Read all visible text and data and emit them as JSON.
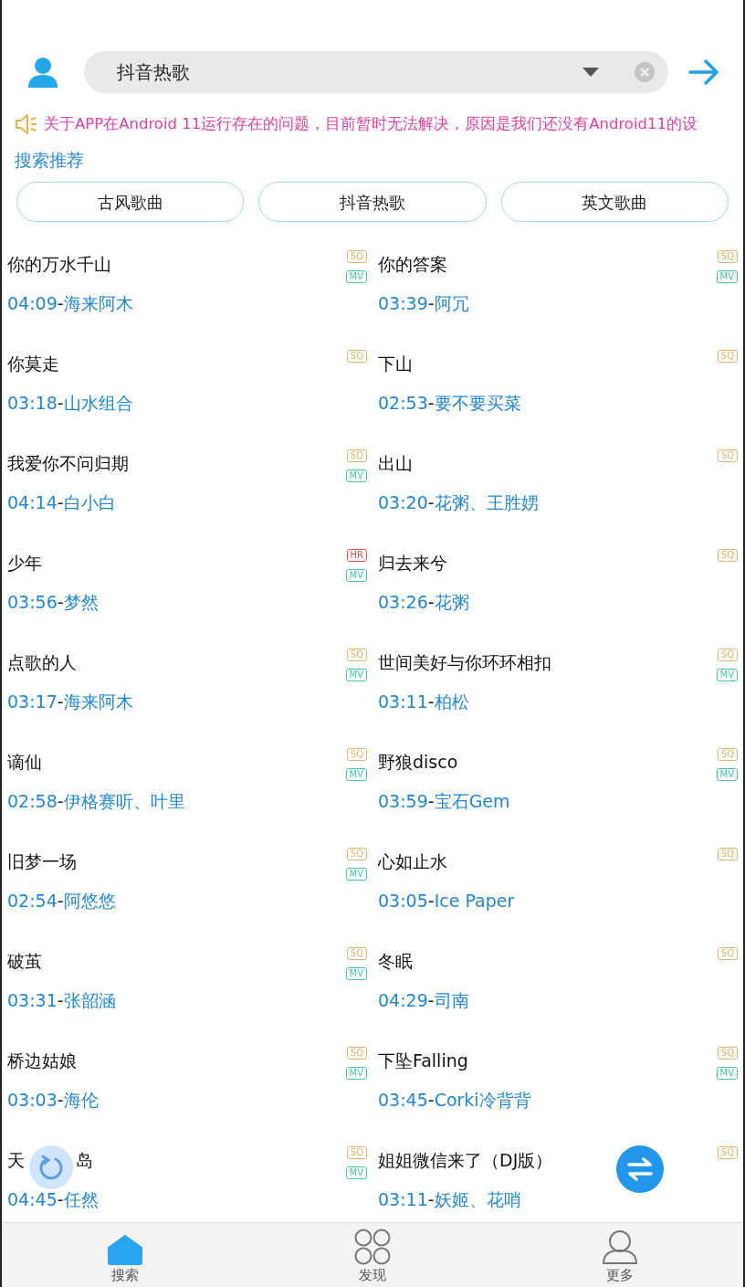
{
  "search": {
    "value": "抖音热歌"
  },
  "notice": "关于APP在Android 11运行存在的问题，目前暂时无法解决，原因是我们还没有Android11的设",
  "recommend": {
    "heading": "搜索推荐",
    "chips": [
      "古风歌曲",
      "抖音热歌",
      "英文歌曲"
    ]
  },
  "songs": [
    {
      "title": "你的万水千山",
      "duration": "04:09",
      "separator": "-",
      "artist": "海来阿木",
      "badges": [
        {
          "kind": "sq",
          "label": "SQ"
        },
        {
          "kind": "mv",
          "label": "MV"
        }
      ]
    },
    {
      "title": "你的答案",
      "duration": "03:39",
      "separator": "-",
      "artist": "阿冗",
      "badges": [
        {
          "kind": "sq",
          "label": "SQ"
        },
        {
          "kind": "mv",
          "label": "MV"
        }
      ]
    },
    {
      "title": "你莫走",
      "duration": "03:18",
      "separator": "-",
      "artist": "山水组合",
      "badges": [
        {
          "kind": "sq",
          "label": "SQ"
        }
      ]
    },
    {
      "title": "下山",
      "duration": "02:53",
      "separator": "-",
      "artist": "要不要买菜",
      "badges": [
        {
          "kind": "sq",
          "label": "SQ"
        }
      ]
    },
    {
      "title": "我爱你不问归期",
      "duration": "04:14",
      "separator": "-",
      "artist": "白小白",
      "badges": [
        {
          "kind": "sq",
          "label": "SQ"
        },
        {
          "kind": "mv",
          "label": "MV"
        }
      ]
    },
    {
      "title": "出山",
      "duration": "03:20",
      "separator": "-",
      "artist": "花粥、王胜娚",
      "badges": [
        {
          "kind": "sq",
          "label": "SQ"
        }
      ]
    },
    {
      "title": "少年",
      "duration": "03:56",
      "separator": "-",
      "artist": "梦然",
      "badges": [
        {
          "kind": "hr",
          "label": "HR"
        },
        {
          "kind": "mv",
          "label": "MV"
        }
      ]
    },
    {
      "title": "归去来兮",
      "duration": "03:26",
      "separator": "-",
      "artist": "花粥",
      "badges": [
        {
          "kind": "sq",
          "label": "SQ"
        }
      ]
    },
    {
      "title": "点歌的人",
      "duration": "03:17",
      "separator": "-",
      "artist": "海来阿木",
      "badges": [
        {
          "kind": "sq",
          "label": "SQ"
        },
        {
          "kind": "mv",
          "label": "MV"
        }
      ]
    },
    {
      "title": "世间美好与你环环相扣",
      "duration": "03:11",
      "separator": "-",
      "artist": "柏松",
      "badges": [
        {
          "kind": "sq",
          "label": "SQ"
        },
        {
          "kind": "mv",
          "label": "MV"
        }
      ]
    },
    {
      "title": "谪仙",
      "duration": "02:58",
      "separator": "-",
      "artist": "伊格赛听、叶里",
      "badges": [
        {
          "kind": "sq",
          "label": "SQ"
        },
        {
          "kind": "mv",
          "label": "MV"
        }
      ]
    },
    {
      "title": "野狼disco",
      "duration": "03:59",
      "separator": "-",
      "artist": "宝石Gem",
      "badges": [
        {
          "kind": "sq",
          "label": "SQ"
        },
        {
          "kind": "mv",
          "label": "MV"
        }
      ]
    },
    {
      "title": "旧梦一场",
      "duration": "02:54",
      "separator": "-",
      "artist": "阿悠悠",
      "badges": [
        {
          "kind": "sq",
          "label": "SQ"
        },
        {
          "kind": "mv",
          "label": "MV"
        }
      ]
    },
    {
      "title": "心如止水",
      "duration": "03:05",
      "separator": "-",
      "artist": "Ice Paper",
      "badges": [
        {
          "kind": "sq",
          "label": "SQ"
        }
      ]
    },
    {
      "title": "破茧",
      "duration": "03:31",
      "separator": "-",
      "artist": "张韶涵",
      "badges": [
        {
          "kind": "sq",
          "label": "SQ"
        },
        {
          "kind": "mv",
          "label": "MV"
        }
      ]
    },
    {
      "title": "冬眠",
      "duration": "04:29",
      "separator": "-",
      "artist": "司南",
      "badges": [
        {
          "kind": "sq",
          "label": "SQ"
        }
      ]
    },
    {
      "title": "桥边姑娘",
      "duration": "03:03",
      "separator": "-",
      "artist": "海伦",
      "badges": [
        {
          "kind": "sq",
          "label": "SQ"
        },
        {
          "kind": "mv",
          "label": "MV"
        }
      ]
    },
    {
      "title": "下坠Falling",
      "duration": "03:45",
      "separator": "-",
      "artist": "Corki冷背背",
      "badges": [
        {
          "kind": "sq",
          "label": "SQ"
        },
        {
          "kind": "mv",
          "label": "MV"
        }
      ]
    },
    {
      "title_start": "天",
      "title_end": "岛",
      "duration": "04:45",
      "separator": "-",
      "artist": "任然",
      "badges": [
        {
          "kind": "sq",
          "label": "SQ"
        },
        {
          "kind": "mv",
          "label": "MV"
        }
      ]
    },
    {
      "title": "姐姐微信来了（DJ版）",
      "duration": "03:11",
      "separator": "-",
      "artist": "妖姬、花哨",
      "badges": [
        {
          "kind": "sq",
          "label": "SQ"
        }
      ]
    }
  ],
  "bottom_nav": [
    {
      "kind": "home",
      "label": "搜索",
      "selected": true
    },
    {
      "kind": "discover",
      "label": "发现",
      "selected": false
    },
    {
      "kind": "profile",
      "label": "更多",
      "selected": false
    }
  ]
}
